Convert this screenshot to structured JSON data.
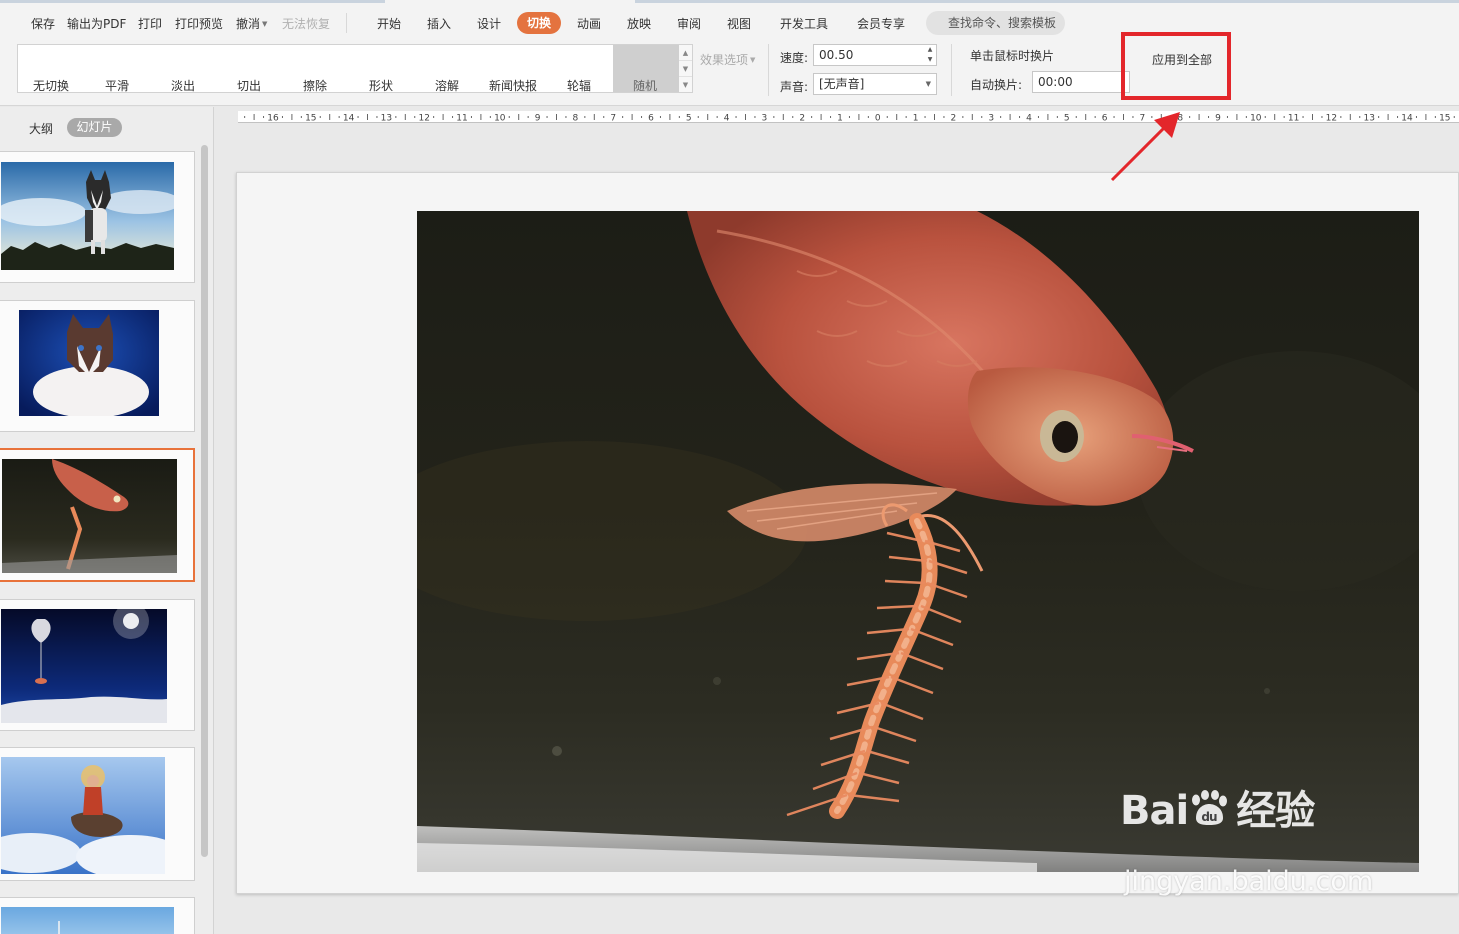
{
  "quick_access": {
    "save": "保存",
    "export_pdf": "输出为PDF",
    "print": "打印",
    "print_preview": "打印预览",
    "undo": "撤消",
    "redo": "无法恢复"
  },
  "tabs": {
    "home": "开始",
    "insert": "插入",
    "design": "设计",
    "transitions": "切换",
    "animation": "动画",
    "slideshow": "放映",
    "review": "审阅",
    "view": "视图",
    "developer": "开发工具",
    "member": "会员专享",
    "search": "查找命令、搜索模板"
  },
  "transitions": {
    "items": [
      "无切换",
      "平滑",
      "淡出",
      "切出",
      "擦除",
      "形状",
      "溶解",
      "新闻快报",
      "轮辐"
    ],
    "random": "随机",
    "effect_options": "效果选项"
  },
  "timing": {
    "speed_label": "速度:",
    "speed_value": "00.50",
    "sound_label": "声音:",
    "sound_value": "[无声音]",
    "on_click_label": "单击鼠标时换片",
    "auto_label": "自动换片:",
    "auto_value": "00:00",
    "apply_all": "应用到全部"
  },
  "panel": {
    "outline_tab": "大纲",
    "slides_tab": "幻灯片",
    "thumbnails": [
      "husky",
      "ragdoll-cat",
      "arowana-fish",
      "balloon-space",
      "figure-on-tiger",
      "blue-sky"
    ],
    "selected_index": 2
  },
  "ruler": {
    "labels": [
      "16",
      "15",
      "14",
      "13",
      "12",
      "11",
      "10",
      "9",
      "8",
      "7",
      "6",
      "5",
      "4",
      "3",
      "2",
      "1",
      "0",
      "1",
      "2",
      "3",
      "4",
      "5",
      "6",
      "7",
      "8",
      "9",
      "10",
      "11",
      "12",
      "13",
      "14",
      "15"
    ]
  },
  "watermark": {
    "logo_text": "Bai",
    "logo_cn": "经验",
    "url": "jingyan.baidu.com"
  },
  "colors": {
    "accent": "#e4733f",
    "highlight": "#e3262b"
  }
}
